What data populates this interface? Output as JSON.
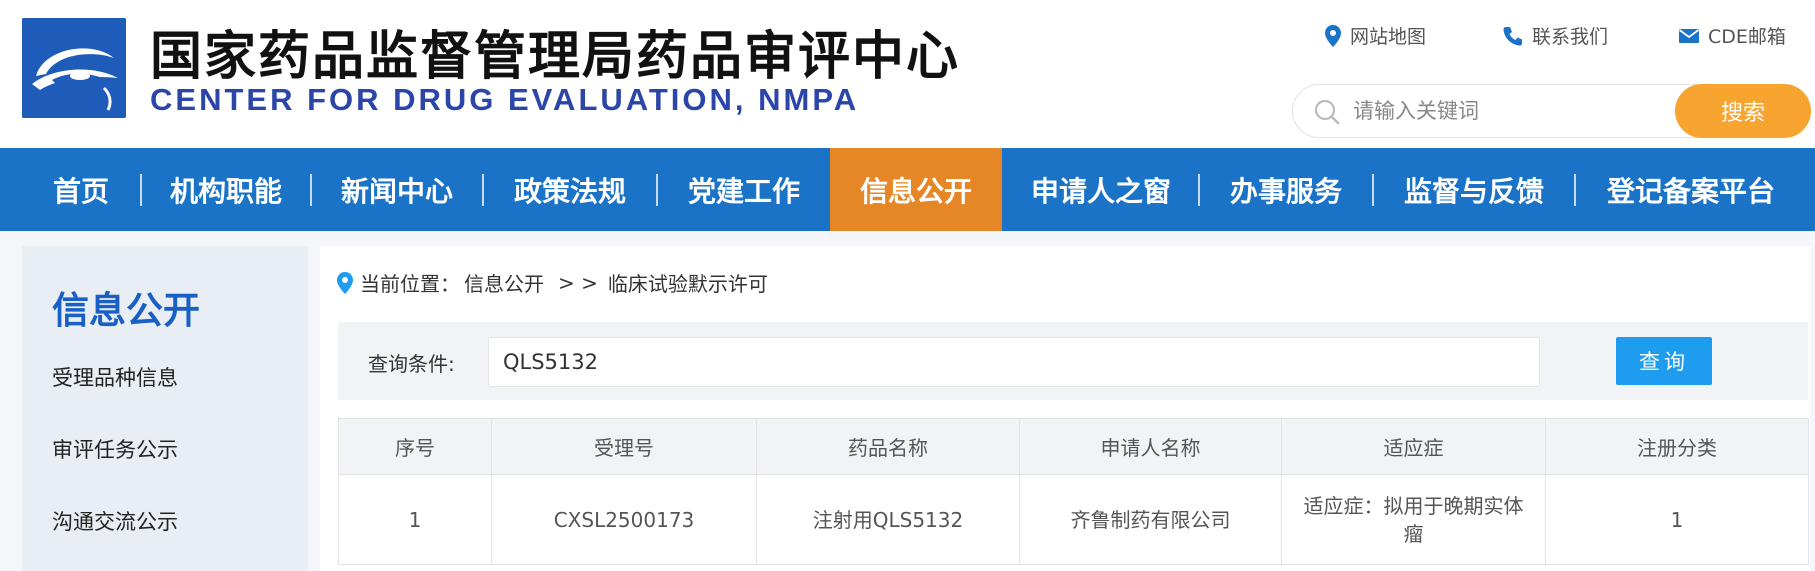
{
  "header": {
    "title_cn": "国家药品监督管理局药品审评中心",
    "title_en": "CENTER FOR DRUG EVALUATION, NMPA",
    "links": [
      {
        "label": "网站地图",
        "icon": "location-pin-icon"
      },
      {
        "label": "联系我们",
        "icon": "phone-icon"
      },
      {
        "label": "CDE邮箱",
        "icon": "mail-icon"
      }
    ],
    "search": {
      "placeholder": "请输入关键词",
      "button_label": "搜索"
    }
  },
  "colors": {
    "nav_bg": "#1a73c7",
    "nav_active": "#e58726",
    "search_button": "#f7a530",
    "query_button": "#1e9df0",
    "title_en": "#2b45a8",
    "sidebar_title": "#1a5fc4"
  },
  "nav": {
    "items": [
      {
        "label": "首页"
      },
      {
        "label": "机构职能"
      },
      {
        "label": "新闻中心"
      },
      {
        "label": "政策法规"
      },
      {
        "label": "党建工作"
      },
      {
        "label": "信息公开",
        "active": true
      },
      {
        "label": "申请人之窗"
      },
      {
        "label": "办事服务"
      },
      {
        "label": "监督与反馈"
      },
      {
        "label": "登记备案平台"
      }
    ]
  },
  "sidebar": {
    "title": "信息公开",
    "items": [
      {
        "label": "受理品种信息"
      },
      {
        "label": "审评任务公示"
      },
      {
        "label": "沟通交流公示"
      }
    ]
  },
  "breadcrumb": {
    "prefix": "当前位置：",
    "section": "信息公开",
    "separator": "> >",
    "page": "临床试验默示许可"
  },
  "query": {
    "label": "查询条件:",
    "value": "QLS5132",
    "button_label": "查询"
  },
  "table": {
    "headers": [
      "序号",
      "受理号",
      "药品名称",
      "申请人名称",
      "适应症",
      "注册分类"
    ],
    "rows": [
      [
        "1",
        "CXSL2500173",
        "注射用QLS5132",
        "齐鲁制药有限公司",
        "适应症：拟用于晚期实体瘤",
        "1"
      ]
    ]
  }
}
